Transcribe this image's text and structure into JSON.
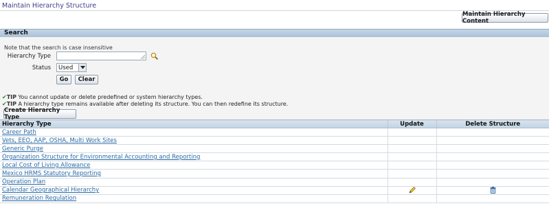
{
  "page": {
    "title": "Maintain Hierarchy Structure"
  },
  "toolbar": {
    "maintain_content_label": "Maintain Hierarchy Content"
  },
  "search": {
    "header": "Search",
    "note": "Note that the search is case insensitive",
    "hierarchy_type_label": "Hierarchy Type",
    "hierarchy_type_value": "",
    "status_label": "Status",
    "status_value": "Used",
    "go_label": "Go",
    "clear_label": "Clear"
  },
  "tips": [
    {
      "prefix": "TIP",
      "text": " You cannot update or delete predefined or system hierarchy types."
    },
    {
      "prefix": "TIP",
      "text": " A hierarchy type remains available after deleting its structure. You can then redefine its structure."
    }
  ],
  "actions": {
    "create_label": "Create Hierarchy Type"
  },
  "table": {
    "headers": {
      "type": "Hierarchy Type",
      "update": "Update",
      "delete": "Delete Structure"
    },
    "rows": [
      {
        "name": "Career Path",
        "update": false,
        "delete": false
      },
      {
        "name": "Vets, EEO, AAP, OSHA, Multi Work Sites",
        "update": false,
        "delete": false
      },
      {
        "name": "Generic Purge",
        "update": false,
        "delete": false
      },
      {
        "name": "Organization Structure for Environmental Accounting and Reporting",
        "update": false,
        "delete": false
      },
      {
        "name": "Local Cost of Living Allowance",
        "update": false,
        "delete": false
      },
      {
        "name": "Mexico HRMS Statutory Reporting",
        "update": false,
        "delete": false
      },
      {
        "name": "Operation Plan",
        "update": false,
        "delete": false
      },
      {
        "name": "Calendar Geographical Hierarchy",
        "update": true,
        "delete": true
      },
      {
        "name": "Remuneration Regulation",
        "update": false,
        "delete": false
      }
    ]
  },
  "colors": {
    "link": "#2a6aa6",
    "header_bg": "#c5d6e6",
    "tip_check": "#2a8a2a"
  },
  "icons": {
    "search": "magnifier-icon",
    "update": "pencil-icon",
    "delete": "trash-icon"
  }
}
